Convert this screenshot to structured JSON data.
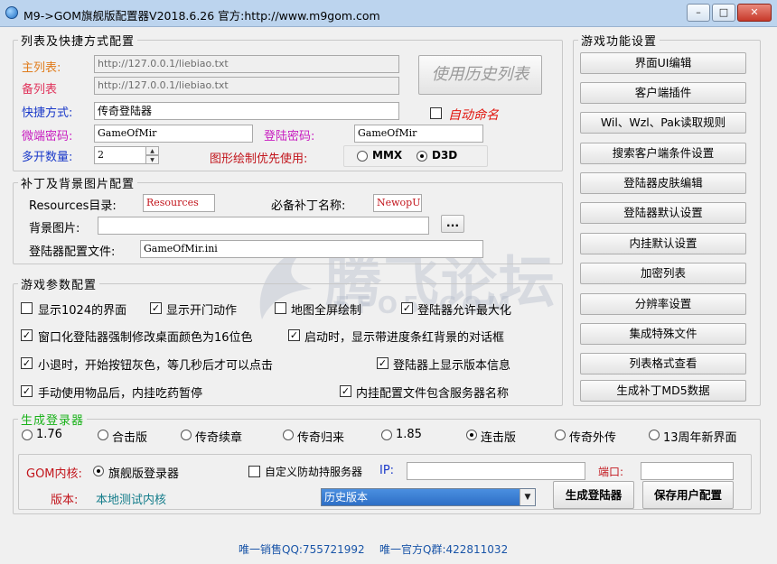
{
  "window": {
    "title": "M9->GOM旗舰版配置器V2018.6.26   官方:http://www.m9gom.com",
    "minimize": "–",
    "maximize": "□",
    "close": "✕"
  },
  "list_section": {
    "title": "列表及快捷方式配置",
    "main_list_label": "主列表:",
    "main_list_value": "http://127.0.0.1/liebiao.txt",
    "backup_list_label": "备列表",
    "backup_list_value": "http://127.0.0.1/liebiao.txt",
    "use_history_button": "使用历史列表",
    "shortcut_label": "快捷方式:",
    "shortcut_value": "传奇登陆器",
    "auto_name_label": "自动命名",
    "micro_pwd_label": "微端密码:",
    "micro_pwd_value": "GameOfMir",
    "login_pwd_label": "登陆密码:",
    "login_pwd_value": "GameOfMir",
    "multi_open_label": "多开数量:",
    "multi_open_value": "2",
    "render_label": "图形绘制优先使用:",
    "render_mmx": "MMX",
    "render_d3d": "D3D"
  },
  "patch_section": {
    "title": "补丁及背景图片配置",
    "resources_label": "Resources目录:",
    "resources_value": "Resources",
    "required_patch_label": "必备补丁名称:",
    "required_patch_value": "NewopUI",
    "bg_image_label": "背景图片:",
    "bg_image_value": "",
    "browse_button": "...",
    "config_file_label": "登陆器配置文件:",
    "config_file_value": "GameOfMir.ini"
  },
  "params_section": {
    "title": "游戏参数配置",
    "options": [
      {
        "label": "显示1024的界面",
        "checked": false
      },
      {
        "label": "显示开门动作",
        "checked": true
      },
      {
        "label": "地图全屏绘制",
        "checked": false
      },
      {
        "label": "登陆器允许最大化",
        "checked": true
      },
      {
        "label": "窗口化登陆器强制修改桌面颜色为16位色",
        "checked": true
      },
      {
        "label": "启动时，显示带进度条红背景的对话框",
        "checked": true
      },
      {
        "label": "小退时，开始按钮灰色，等几秒后才可以点击",
        "checked": true
      },
      {
        "label": "登陆器上显示版本信息",
        "checked": true
      },
      {
        "label": "手动使用物品后，内挂吃药暂停",
        "checked": true
      },
      {
        "label": "内挂配置文件包含服务器名称",
        "checked": true
      }
    ]
  },
  "game_settings": {
    "title": "游戏功能设置",
    "buttons": [
      "界面UI编辑",
      "客户端插件",
      "Wil、Wzl、Pak读取规则",
      "搜索客户端条件设置",
      "登陆器皮肤编辑",
      "登陆器默认设置",
      "内挂默认设置",
      "加密列表",
      "分辨率设置",
      "集成特殊文件",
      "列表格式查看",
      "生成补丁MD5数据"
    ]
  },
  "generate_section": {
    "title": "生成登录器",
    "versions": [
      {
        "label": "1.76",
        "selected": false
      },
      {
        "label": "合击版",
        "selected": false
      },
      {
        "label": "传奇续章",
        "selected": false
      },
      {
        "label": "传奇归来",
        "selected": false
      },
      {
        "label": "1.85",
        "selected": false
      },
      {
        "label": "连击版",
        "selected": true
      },
      {
        "label": "传奇外传",
        "selected": false
      },
      {
        "label": "13周年新界面",
        "selected": false
      }
    ],
    "gom_core_label": "GOM内核:",
    "flagship_label": "旗舰版登录器",
    "custom_server_label": "自定义防劫持服务器",
    "ip_label": "IP:",
    "ip_value": "",
    "port_label": "端口:",
    "port_value": "",
    "version_label": "版本:",
    "version_value": "本地测试内核",
    "history_select": "历史版本",
    "generate_button": "生成登陆器",
    "save_button": "保存用户配置"
  },
  "footer": {
    "sales_qq": "唯一销售QQ:755721992",
    "official_group": "唯一官方Q群:422811032"
  },
  "watermark": {
    "text": "腾飞论坛",
    "sub": "5FO5.COM"
  }
}
